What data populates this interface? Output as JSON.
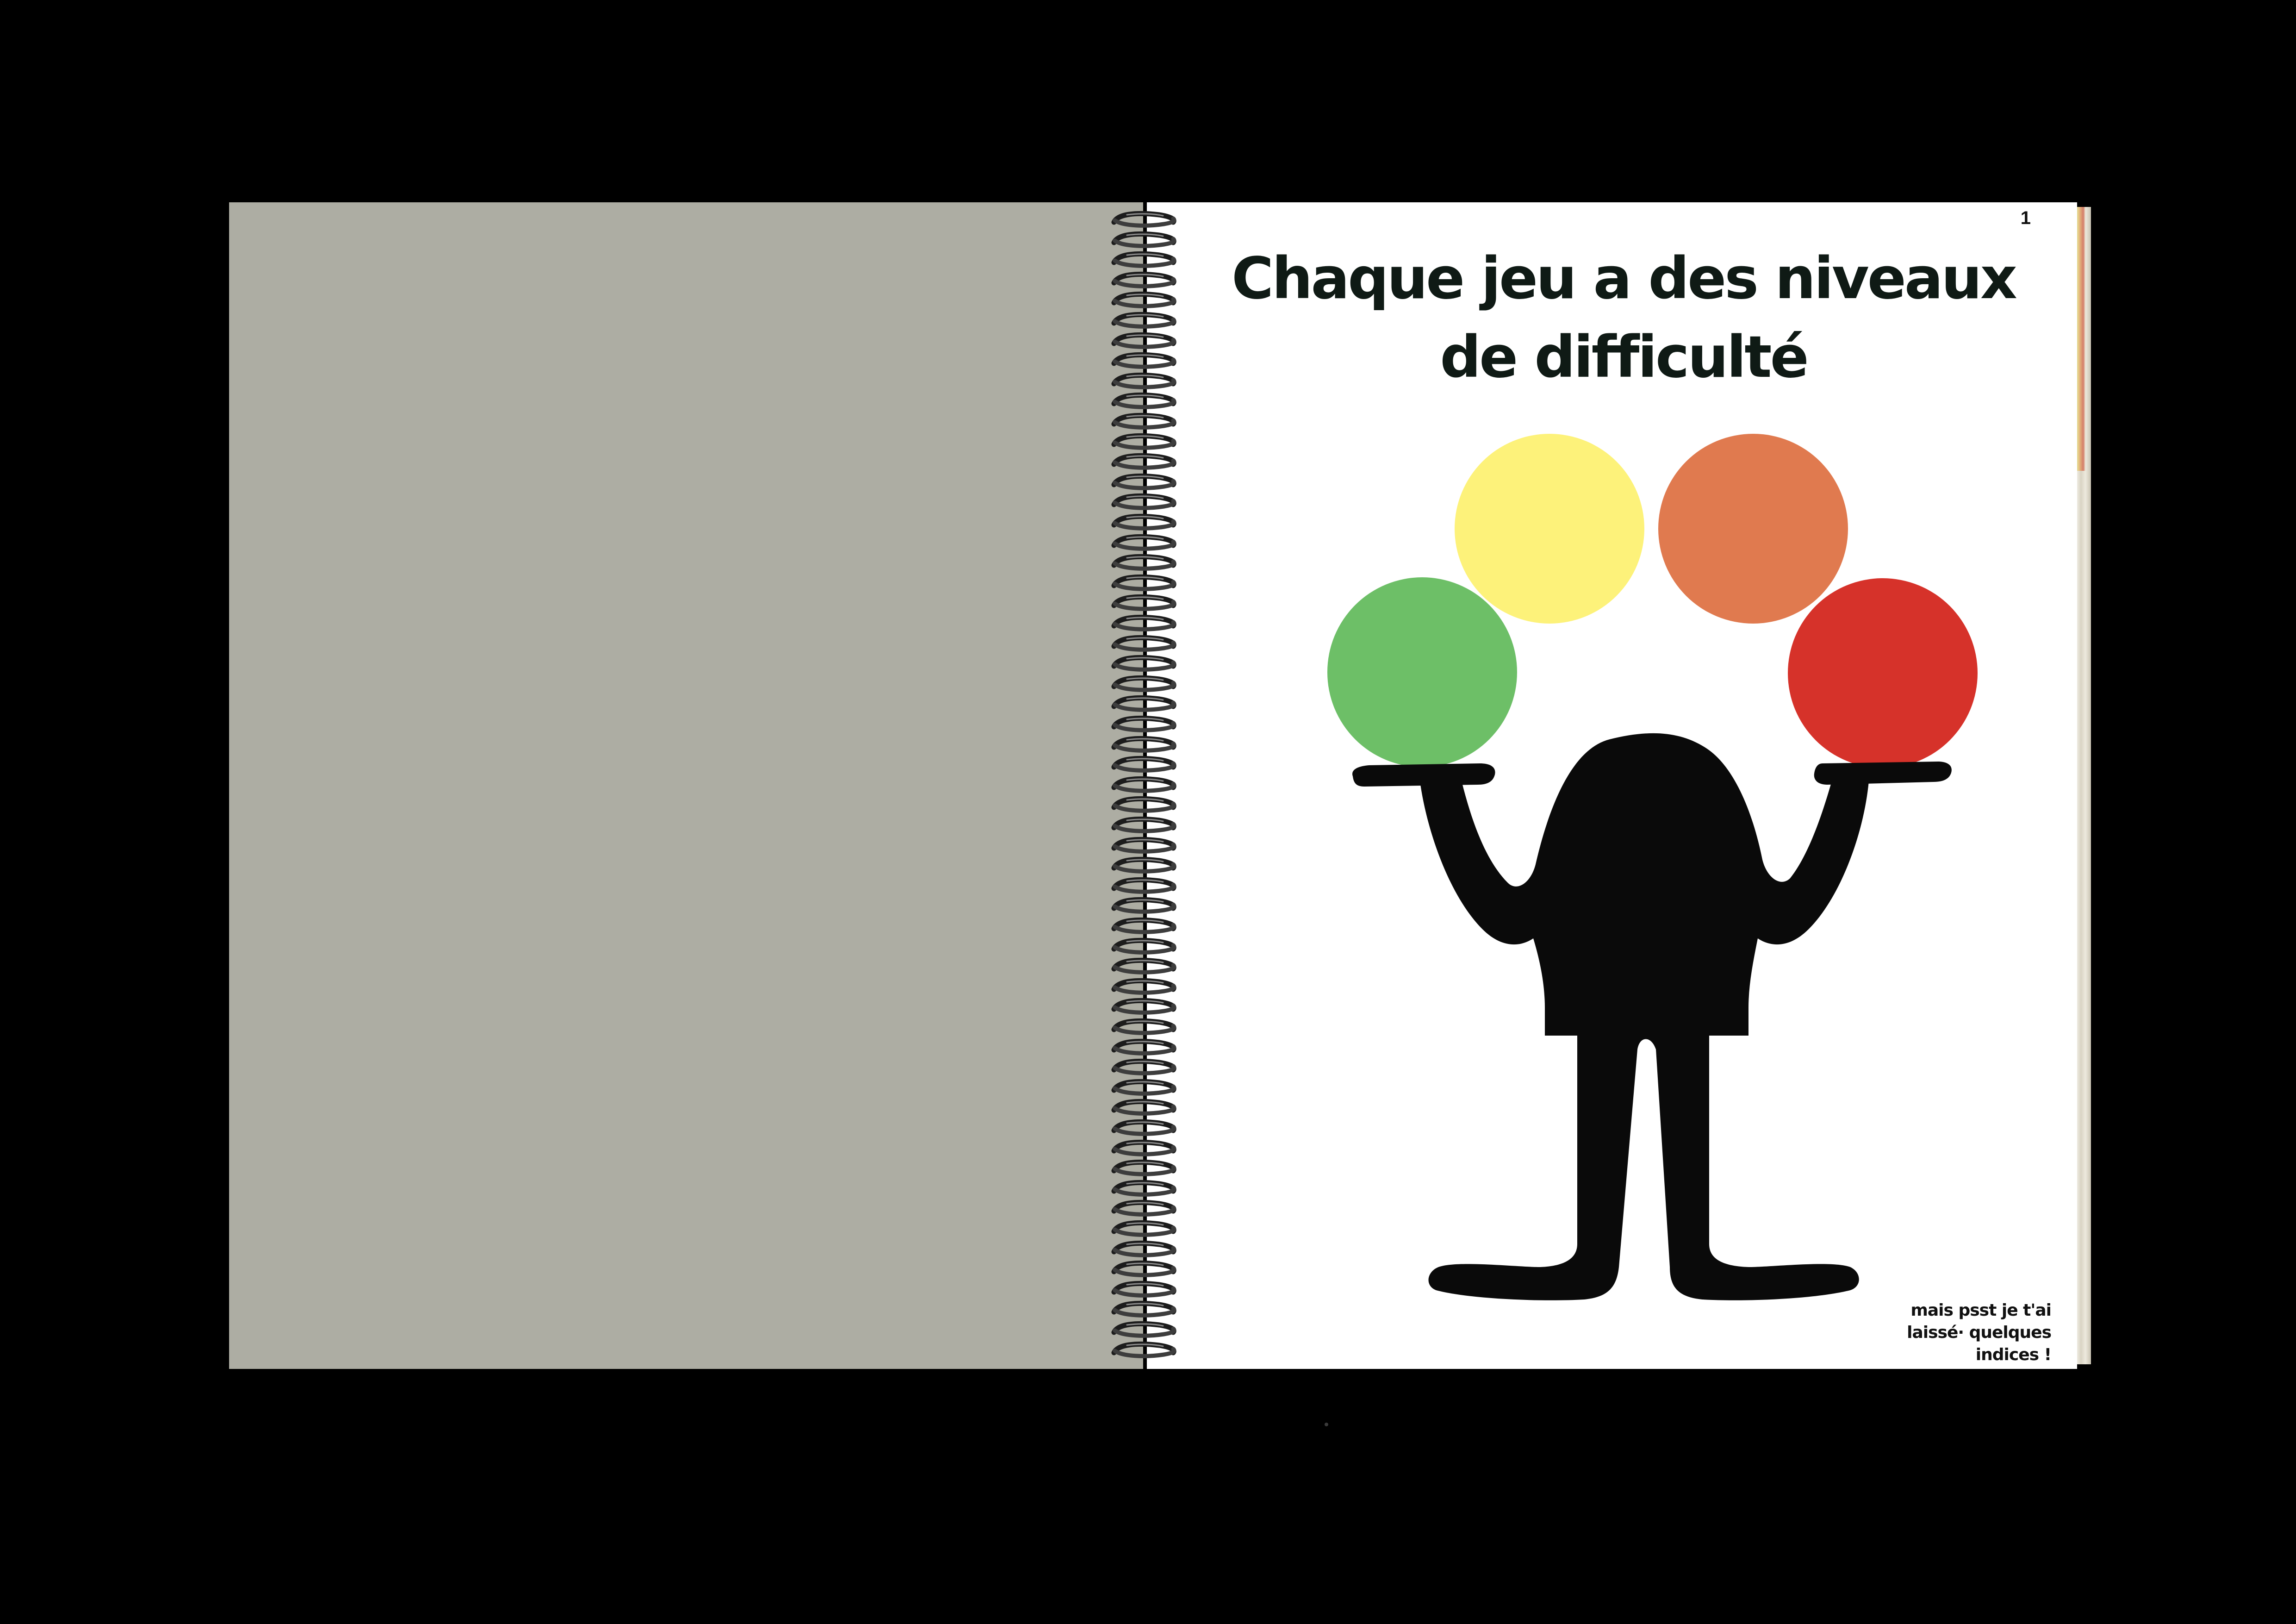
{
  "page": {
    "number": "1",
    "title_lines": [
      "Chaque jeu a des niveaux",
      "de difficulté"
    ],
    "hint_lines": [
      "mais psst je t'ai",
      "laissé· quelques",
      "indices !"
    ]
  },
  "illustration": {
    "figure": "juggler-silhouette",
    "balls": [
      {
        "name": "green-ball",
        "color": "#6dbf67"
      },
      {
        "name": "yellow-ball",
        "color": "#fdf27a"
      },
      {
        "name": "orange-ball",
        "color": "#e07a4f"
      },
      {
        "name": "red-ball",
        "color": "#d6322a"
      }
    ],
    "figure_color": "#0a0a0a"
  },
  "colors": {
    "background": "#000000",
    "left_page": "#adada3",
    "right_page": "#ffffff",
    "text": "#0f1a15"
  }
}
